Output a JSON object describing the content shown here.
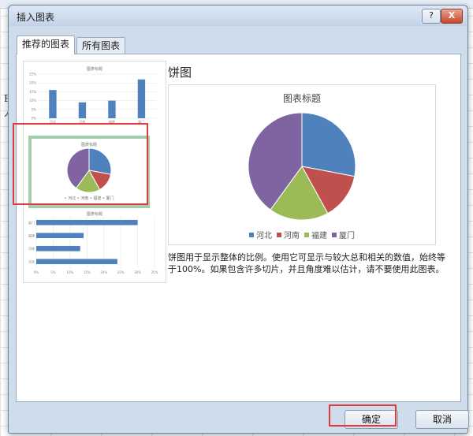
{
  "window": {
    "title": "插入图表",
    "help_label": "?",
    "close_label": "X"
  },
  "tabs": [
    {
      "label": "推荐的图表",
      "active": true
    },
    {
      "label": "所有图表",
      "active": false
    }
  ],
  "thumbnails": {
    "bar": {
      "title": "图表标题",
      "categories": [
        "河北",
        "河南",
        "福建",
        "厦门"
      ],
      "values": [
        16,
        9,
        10,
        22
      ],
      "axis_ticks": [
        "0%",
        "5%",
        "10%",
        "15%",
        "20%",
        "25%"
      ]
    },
    "pie": {
      "title": "图表标题",
      "legend": "• 河北 • 河南 • 福建 • 厦门"
    },
    "hbar": {
      "title": "图表标题",
      "categories": [
        "厦门",
        "福建",
        "河南",
        "河北"
      ],
      "values": [
        30,
        14,
        13,
        24
      ],
      "axis_ticks": [
        "0%",
        "5%",
        "10%",
        "15%",
        "20%",
        "25%",
        "30%",
        "35%"
      ]
    }
  },
  "preview": {
    "heading": "饼图",
    "description": "饼图用于显示整体的比例。使用它可显示与较大总和相关的数值，始终等于100%。如果包含许多切片，并且角度难以估计，请不要使用此图表。"
  },
  "chart_data": {
    "type": "pie",
    "title": "图表标题",
    "categories": [
      "河北",
      "河南",
      "福建",
      "厦门"
    ],
    "values": [
      28,
      14,
      18,
      40
    ],
    "colors": [
      "#4f81bd",
      "#c0504d",
      "#9bbb59",
      "#8064a2"
    ],
    "legend": "bottom"
  },
  "buttons": {
    "ok": "确定",
    "cancel": "取消"
  },
  "backdrop": {
    "letters": [
      "B",
      "人"
    ]
  }
}
